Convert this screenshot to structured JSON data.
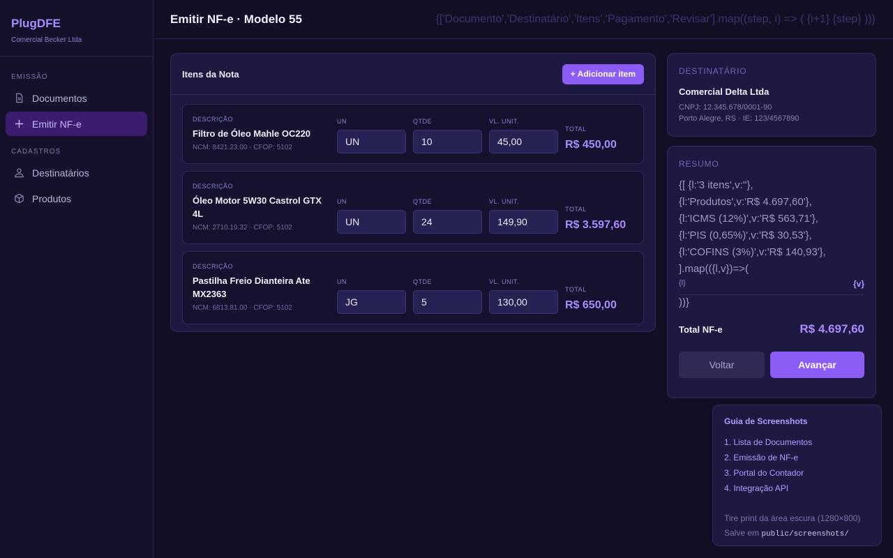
{
  "app": {
    "name": "PlugDFE",
    "company": "Comercial Becker Ltda"
  },
  "sidebar": {
    "sections": [
      {
        "title": "EMISSÃO",
        "items": [
          {
            "label": "Documentos",
            "icon": "document-icon"
          },
          {
            "label": "Emitir NF-e",
            "icon": "plus-icon",
            "active": true
          }
        ]
      },
      {
        "title": "CADASTROS",
        "items": [
          {
            "label": "Destinatários",
            "icon": "user-icon"
          },
          {
            "label": "Produtos",
            "icon": "box-icon"
          }
        ]
      }
    ]
  },
  "header": {
    "title": "Emitir NF-e · Modelo 55",
    "stepper_text": "{['Documento','Destinatário','Itens','Pagamento','Revisar'].map((step, i) => ( {i+1} {step} ))}"
  },
  "items_panel": {
    "title": "Itens da Nota",
    "add_label": "+ Adicionar item",
    "labels": {
      "descricao": "DESCRIÇÃO",
      "un": "UN",
      "qtde": "QTDE",
      "vl_unit": "VL. UNIT.",
      "total": "TOTAL"
    },
    "items": [
      {
        "name": "Filtro de Óleo Mahle OC220",
        "meta": "NCM: 8421.23.00 · CFOP: 5102",
        "un": "UN",
        "qtde": "10",
        "vl_unit": "45,00",
        "total": "R$ 450,00"
      },
      {
        "name": "Óleo Motor 5W30 Castrol GTX 4L",
        "meta": "NCM: 2710.19.32 · CFOP: 5102",
        "un": "UN",
        "qtde": "24",
        "vl_unit": "149,90",
        "total": "R$ 3.597,60"
      },
      {
        "name": "Pastilha Freio Dianteira Ate MX2363",
        "meta": "NCM: 6813.81.00 · CFOP: 5102",
        "un": "JG",
        "qtde": "5",
        "vl_unit": "130,00",
        "total": "R$ 650,00"
      }
    ]
  },
  "destinatario": {
    "label": "DESTINATÁRIO",
    "name": "Comercial Delta Ltda",
    "cnpj": "CNPJ: 12.345.678/0001-90",
    "location": "Porto Alegre, RS · IE: 123/4567890"
  },
  "resumo": {
    "label": "RESUMO",
    "raw_lines": [
      "{[ {l:'3 itens',v:''},",
      "{l:'Produtos',v:'R$ 4.697,60'},",
      "{l:'ICMS (12%)',v:'R$ 563,71'},",
      "{l:'PIS (0,65%)',v:'R$ 30,53'},",
      "{l:'COFINS (3%)',v:'R$ 140,93'},",
      "].map(({l,v})=>("
    ],
    "row_l": "{l}",
    "row_v": "{v}",
    "close": "))}",
    "total_label": "Total NF-e",
    "total_value": "R$ 4.697,60",
    "back_label": "Voltar",
    "next_label": "Avançar"
  },
  "guide": {
    "title": "Guia de Screenshots",
    "items": [
      "1. Lista de Documentos",
      "2. Emissão de NF-e",
      "3. Portal do Contador",
      "4. Integração API"
    ],
    "note": "Tire print da área escura (1280×800)",
    "save_prefix": "Salve em",
    "save_path": "public/screenshots/"
  }
}
